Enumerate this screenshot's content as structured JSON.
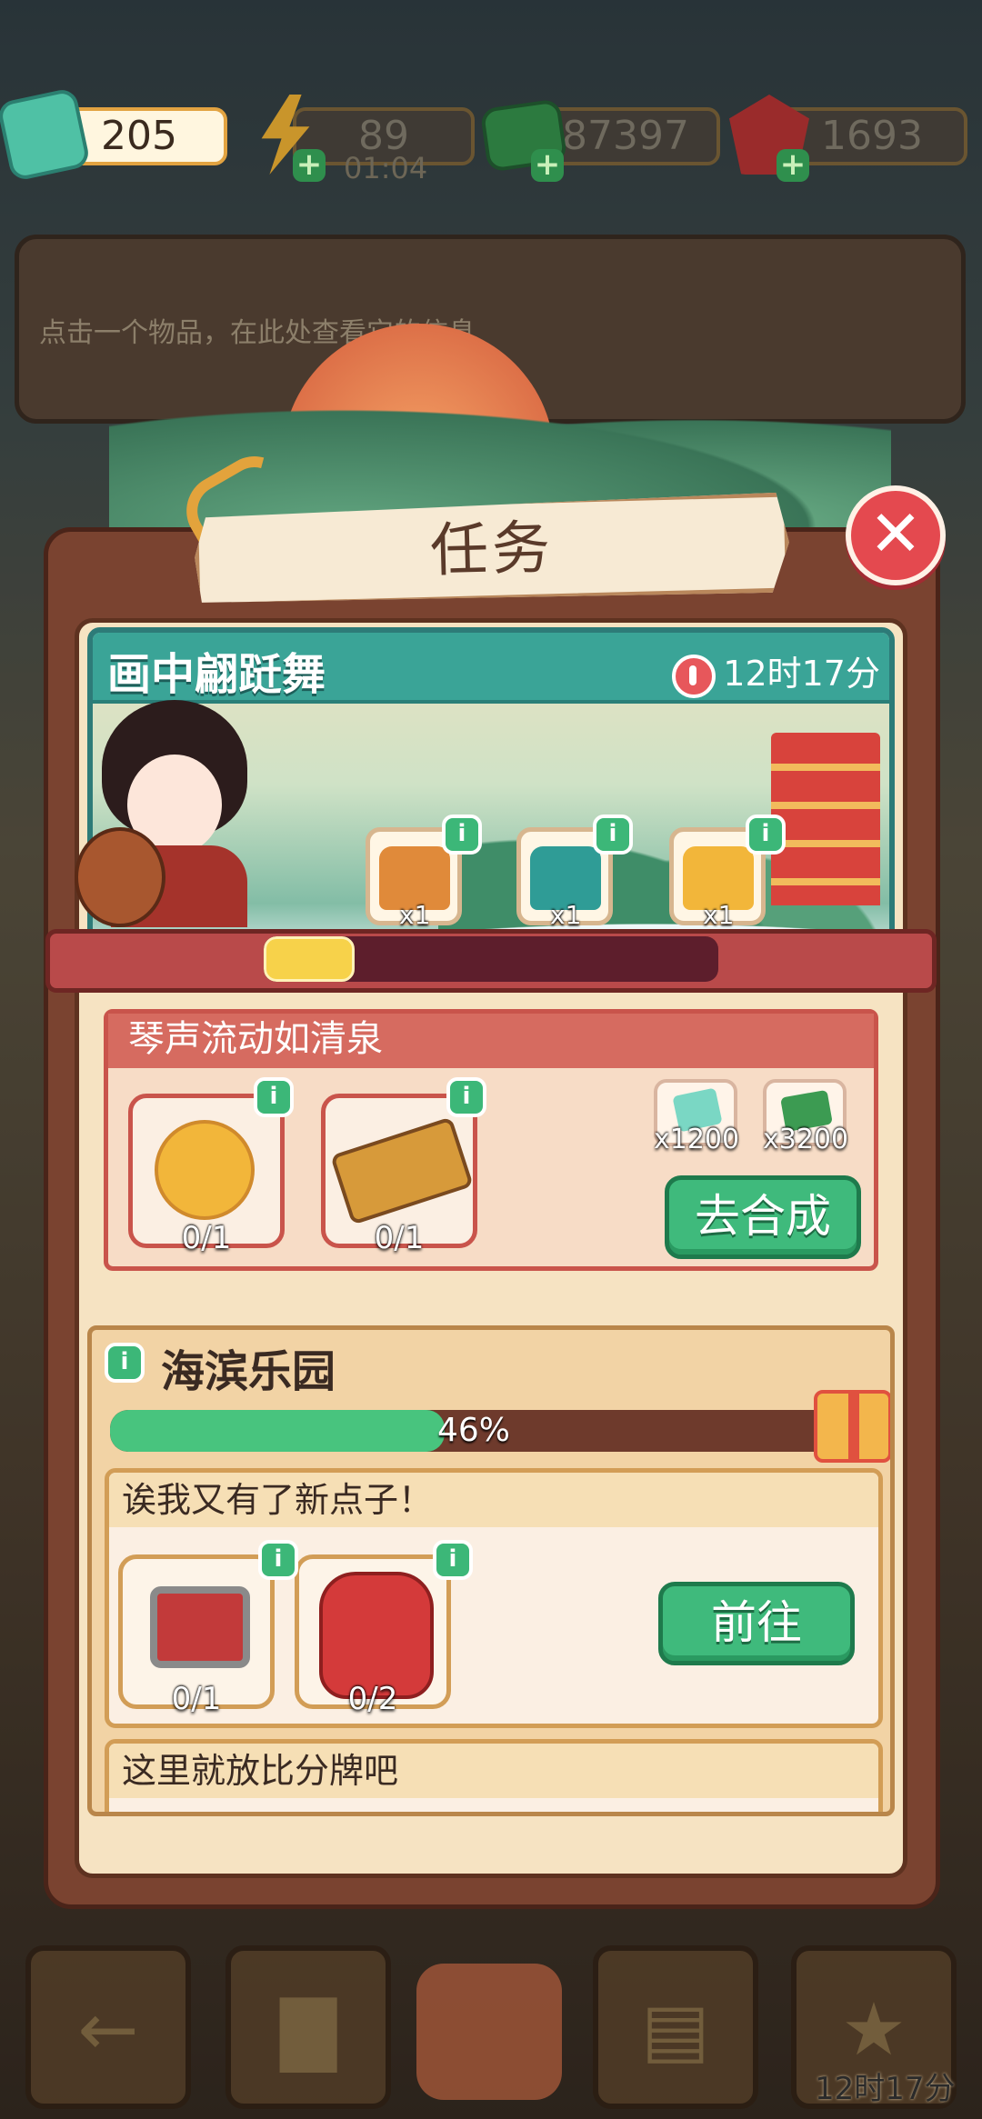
{
  "resources": {
    "tickets": "205",
    "energy": "89",
    "energy_timer": "01:04",
    "cash": "87397",
    "gems": "1693"
  },
  "info_hint": "点击一个物品，在此处查看它的信息",
  "panel": {
    "title": "任务",
    "close": "✕"
  },
  "event": {
    "name": "画中翩跹舞",
    "timer": "12时17分",
    "progress": 0.2,
    "chests": [
      {
        "qty": "x1",
        "color": "#e08a3a"
      },
      {
        "qty": "x1",
        "color": "#2f9c96"
      },
      {
        "qty": "x1",
        "color": "#f2b63a"
      }
    ]
  },
  "subtask1": {
    "title": "琴声流动如清泉",
    "items": [
      {
        "count": "0/1",
        "icon": "golden-fish-icon"
      },
      {
        "count": "0/1",
        "icon": "guzheng-icon"
      }
    ],
    "rewards": [
      {
        "qty": "x1200",
        "icon": "ticket-icon"
      },
      {
        "qty": "x3200",
        "icon": "cash-icon"
      }
    ],
    "button": "去合成"
  },
  "quest2": {
    "title": "海滨乐园",
    "progress_label": "46%",
    "progress": 0.46,
    "tasks": [
      {
        "title": "诶我又有了新点子！",
        "items": [
          {
            "count": "0/1",
            "icon": "saw-icon"
          },
          {
            "count": "0/2",
            "icon": "glove-icon"
          }
        ],
        "button": "前往"
      },
      {
        "title": "这里就放比分牌吧"
      }
    ]
  },
  "info_glyph": "i",
  "bottom": {
    "timer": "12时17分"
  }
}
